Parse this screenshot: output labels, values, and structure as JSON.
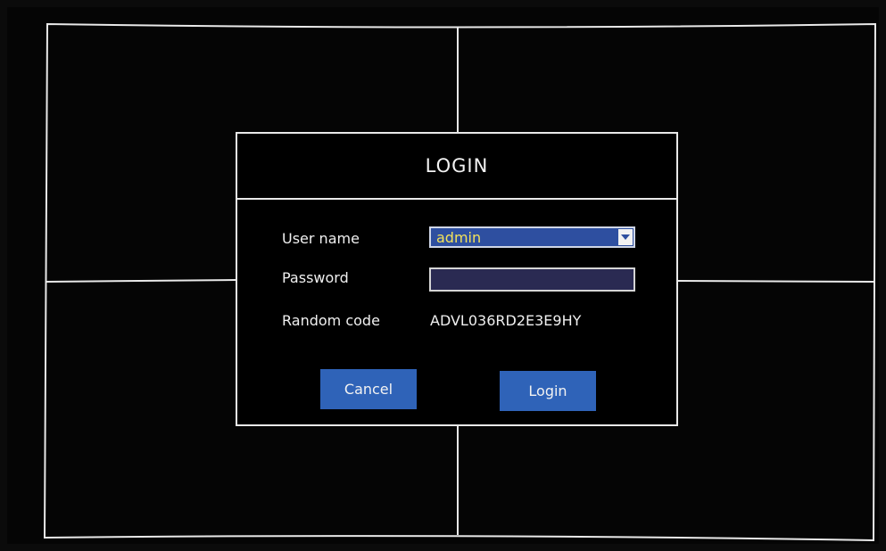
{
  "dialog": {
    "title": "LOGIN",
    "username_label": "User name",
    "username_value": "admin",
    "password_label": "Password",
    "password_value": "",
    "random_code_label": "Random code",
    "random_code_value": "ADVL036RD2E3E9HY",
    "cancel_label": "Cancel",
    "login_label": "Login"
  },
  "icons": {
    "dropdown": "chevron-down-icon"
  },
  "colors": {
    "background": "#050505",
    "grid_lines": "#e9e9e9",
    "button": "#2f63b8",
    "select_bg": "#2e4fa0",
    "select_text": "#f3e25a",
    "password_bg": "#2a2a52"
  }
}
